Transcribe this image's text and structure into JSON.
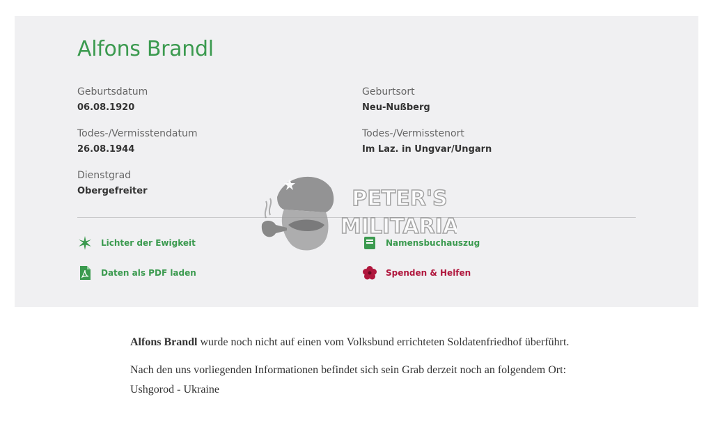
{
  "person": {
    "name": "Alfons Brandl",
    "birth_date_label": "Geburtsdatum",
    "birth_date": "06.08.1920",
    "birth_place_label": "Geburtsort",
    "birth_place": "Neu-Nußberg",
    "death_date_label": "Todes-/Vermisstendatum",
    "death_date": "26.08.1944",
    "death_place_label": "Todes-/Vermisstenort",
    "death_place": "Im Laz. in Ungvar/Ungarn",
    "rank_label": "Dienstgrad",
    "rank": "Obergefreiter"
  },
  "actions": {
    "lights": "Lichter der Ewigkeit",
    "name_book": "Namensbuchauszug",
    "pdf": "Daten als PDF laden",
    "donate": "Spenden & Helfen"
  },
  "watermark": {
    "line1": "PETER'S",
    "line2": "MILITARIA"
  },
  "body": {
    "p1_name": "Alfons Brandl",
    "p1_rest": " wurde noch nicht auf einen vom Volksbund errichteten Soldatenfriedhof überführt.",
    "p2": "Nach den uns vorliegenden Informationen befindet sich sein Grab derzeit noch an folgendem Ort: Ushgorod - Ukraine"
  },
  "colors": {
    "accent_green": "#3b9a4f",
    "accent_red": "#b0173d",
    "card_bg": "#f0f0f2"
  }
}
